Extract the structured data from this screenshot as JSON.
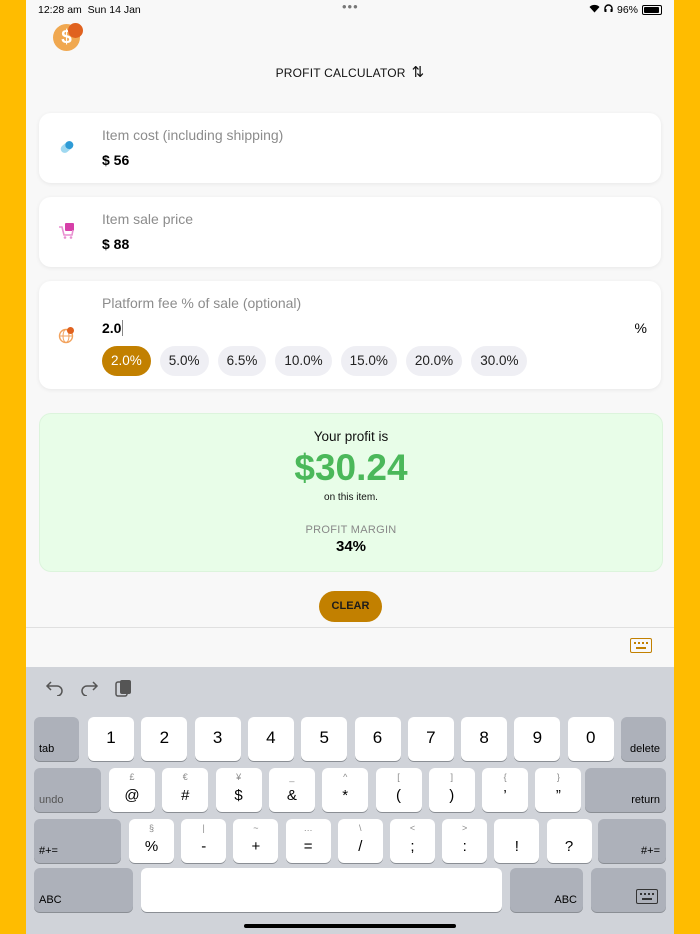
{
  "status": {
    "time": "12:28 am",
    "date": "Sun 14 Jan",
    "battery": "96%",
    "wifi": "wifi-icon",
    "headphones": "headphones-icon"
  },
  "header": {
    "title": "PROFIT CALCULATOR",
    "sort_icon": "sort-arrows-icon"
  },
  "fields": {
    "cost": {
      "label": "Item cost (including shipping)",
      "value": "$ 56",
      "icon": "bandage-icon"
    },
    "sale": {
      "label": "Item sale price",
      "value": "$ 88",
      "icon": "shopping-cart-icon"
    },
    "fee": {
      "label": "Platform fee % of sale (optional)",
      "value": "2.0",
      "unit": "%",
      "icon": "globe-icon",
      "chips": [
        "2.0%",
        "5.0%",
        "6.5%",
        "10.0%",
        "15.0%",
        "20.0%",
        "30.0%"
      ],
      "selected": "2.0%"
    }
  },
  "result": {
    "lead": "Your profit is",
    "amount": "$30.24",
    "tail": "on this item.",
    "margin_label": "PROFIT MARGIN",
    "margin_value": "34%"
  },
  "clear_label": "CLEAR",
  "colors": {
    "accent": "#C28000",
    "profit": "#4BB85A",
    "result_bg": "#E8FDE8",
    "side_bar": "#FFBC00"
  },
  "keyboard": {
    "toolbar": [
      "undo-icon",
      "redo-icon",
      "paste-icon"
    ],
    "row1": {
      "tab": "tab",
      "keys": [
        "1",
        "2",
        "3",
        "4",
        "5",
        "6",
        "7",
        "8",
        "9",
        "0"
      ],
      "delete": "delete"
    },
    "row2": {
      "undo": "undo",
      "keys": [
        {
          "m": "@",
          "s": "£"
        },
        {
          "m": "#",
          "s": "€"
        },
        {
          "m": "$",
          "s": "¥"
        },
        {
          "m": "&",
          "s": "_"
        },
        {
          "m": "*",
          "s": "^"
        },
        {
          "m": "(",
          "s": "["
        },
        {
          "m": ")",
          "s": "]"
        },
        {
          "m": "’",
          "s": "{"
        },
        {
          "m": "”",
          "s": "}"
        }
      ],
      "return": "return"
    },
    "row3": {
      "shift": "#+=",
      "keys": [
        {
          "m": "%",
          "s": "§"
        },
        {
          "m": "-",
          "s": "|"
        },
        {
          "m": "+",
          "s": "~"
        },
        {
          "m": "=",
          "s": "…"
        },
        {
          "m": "/",
          "s": "\\"
        },
        {
          "m": ";",
          "s": "<"
        },
        {
          "m": ":",
          "s": ">"
        },
        {
          "m": "!",
          "s": ""
        },
        {
          "m": "?",
          "s": ""
        }
      ],
      "shift_right": "#+="
    },
    "row4": {
      "left": "ABC",
      "right": "ABC"
    }
  }
}
